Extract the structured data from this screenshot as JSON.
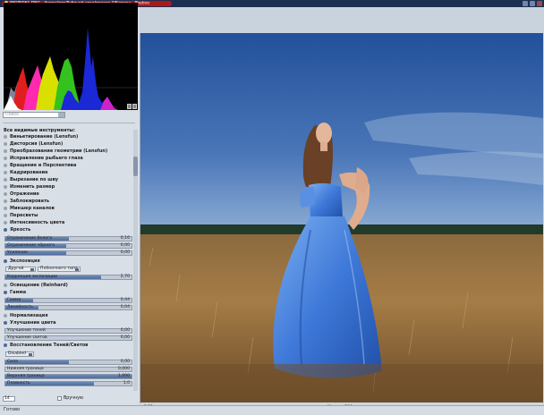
{
  "window": {
    "title": "IMGP5061.DNG - /home/igor/Рабочий стол/проект 3/Катюха - Photivo"
  },
  "search": {
    "placeholder": "Поиск"
  },
  "tools_section_title": "Все видимые инструменты:",
  "tools": [
    {
      "label": "Виньетирование (Lensfun)"
    },
    {
      "label": "Дисторсия (Lensfun)"
    },
    {
      "label": "Преобразование геометрии (Lensfun)"
    },
    {
      "label": "Исправление рыбьего глаза"
    },
    {
      "label": "Вращение и Перспектива"
    },
    {
      "label": "Кадрирование"
    },
    {
      "label": "Вырезание по шву"
    },
    {
      "label": "Изменить размер"
    },
    {
      "label": "Отражение"
    },
    {
      "label": "Заблокировать"
    },
    {
      "label": "Микшер каналов"
    },
    {
      "label": "Пересветы"
    },
    {
      "label": "Интенсивность цвета"
    },
    {
      "label": "Яркость"
    }
  ],
  "brightness_sliders": [
    {
      "label": "Ограничение белого",
      "value": "0,16",
      "fill": 0.5
    },
    {
      "label": "Ограничение чёрного",
      "value": "0,00",
      "fill": 0.48
    },
    {
      "label": "Усиление",
      "value": "0,00",
      "fill": 0.48
    }
  ],
  "exposure": {
    "title": "Экспозиция",
    "mode_value": "Другой",
    "curve_value": "Плёночного типа",
    "slider": {
      "label": "Коррекция экспозиции",
      "value": "2,70",
      "fill": 0.76
    }
  },
  "reinhard": {
    "title": "Освещение (Reinhard)"
  },
  "gamma": {
    "title": "Гамма",
    "sliders": [
      {
        "label": "Гамма",
        "value": "0,44",
        "fill": 0.22
      },
      {
        "label": "Линейность",
        "value": "0,04",
        "fill": 0.26
      }
    ]
  },
  "normalization": {
    "title": "Нормализация"
  },
  "color_enhance": {
    "title": "Улучшение цвета",
    "sliders": [
      {
        "label": "Улучшение теней",
        "value": "0,00",
        "fill": 0
      },
      {
        "label": "Улучшение светов",
        "value": "0,00",
        "fill": 0
      }
    ]
  },
  "shadows_highlights": {
    "title": "Восстановление Теней/Светов",
    "mode_value": "Disabled",
    "sliders": [
      {
        "label": "Сила",
        "value": "0,00",
        "fill": 0.5
      },
      {
        "label": "Нижняя граница",
        "value": "0,000",
        "fill": 0
      },
      {
        "label": "Верхняя граница",
        "value": "1,000",
        "fill": 1
      },
      {
        "label": "Плавность",
        "value": "1,0",
        "fill": 0.7
      }
    ]
  },
  "bottom": {
    "spin_value": "14",
    "manual_label": "Вручную",
    "color_mode": "RGB",
    "zoom_label": "Масштаб",
    "zoom_value": "100",
    "status": "Готово"
  },
  "colors": {
    "accent": "#5a78a8",
    "titlebar": "#1c2e52",
    "title_pill": "#b01818"
  }
}
